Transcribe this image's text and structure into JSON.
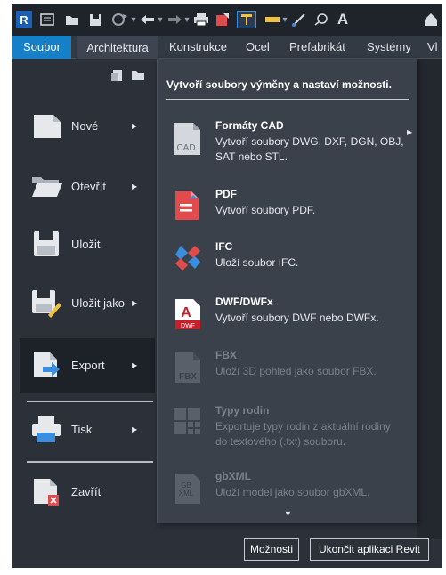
{
  "toolbar": {
    "app_logo": "R",
    "icons": [
      "info-icon",
      "open-icon",
      "save-icon",
      "sync-icon",
      "undo-icon",
      "redo-icon",
      "print-icon",
      "export-icon",
      "align-icon",
      "measure-icon",
      "line-icon",
      "tag-icon",
      "text-icon",
      "home-icon"
    ]
  },
  "tabs": [
    "Soubor",
    "Architektura",
    "Konstrukce",
    "Ocel",
    "Prefabrikát",
    "Systémy",
    "Vl"
  ],
  "left_menu": {
    "items": [
      {
        "label": "Nové",
        "has_arrow": true,
        "active": false
      },
      {
        "label": "Otevřít",
        "has_arrow": true,
        "active": false
      },
      {
        "label": "Uložit",
        "has_arrow": false,
        "active": false
      },
      {
        "label": "Uložit jako",
        "has_arrow": true,
        "active": false
      },
      {
        "label": "Export",
        "has_arrow": true,
        "active": true
      },
      {
        "label": "Tisk",
        "has_arrow": true,
        "active": false
      },
      {
        "label": "Zavřít",
        "has_arrow": false,
        "active": false
      }
    ],
    "arrow": "▶"
  },
  "submenu": {
    "header": "Vytvoří soubory výměny a nastaví možnosti.",
    "items": [
      {
        "title": "Formáty CAD",
        "desc": "Vytvoří soubory DWG, DXF, DGN, OBJ, SAT nebo STL.",
        "icon_text": "CAD",
        "disabled": false,
        "has_arrow": true
      },
      {
        "title": "PDF",
        "desc": "Vytvoří soubory PDF.",
        "icon_text": "",
        "disabled": false,
        "has_arrow": false
      },
      {
        "title": "IFC",
        "desc": "Uloží soubor IFC.",
        "icon_text": "",
        "disabled": false,
        "has_arrow": false
      },
      {
        "title": "DWF/DWFx",
        "desc": "Vytvoří soubory DWF nebo DWFx.",
        "icon_text": "DWF",
        "disabled": false,
        "has_arrow": false
      },
      {
        "title": "FBX",
        "desc": "Uloží 3D pohled jako soubor FBX.",
        "icon_text": "FBX",
        "disabled": true,
        "has_arrow": false
      },
      {
        "title": "Typy rodin",
        "desc": "Exportuje typy rodin z aktuální rodiny do textového (.txt) souboru.",
        "icon_text": "",
        "disabled": true,
        "has_arrow": false
      },
      {
        "title": "gbXML",
        "desc": "Uloží model jako soubor gbXML.",
        "icon_text": "GB XML",
        "disabled": true,
        "has_arrow": false
      }
    ],
    "arrow": "▶",
    "scroll_glyph": "▼"
  },
  "buttons": {
    "options": "Možnosti",
    "exit": "Ukončit aplikaci Revit"
  },
  "colors": {
    "accent": "#1580c8",
    "pdf_red": "#e24b4b",
    "dwf_red": "#c8202a"
  }
}
